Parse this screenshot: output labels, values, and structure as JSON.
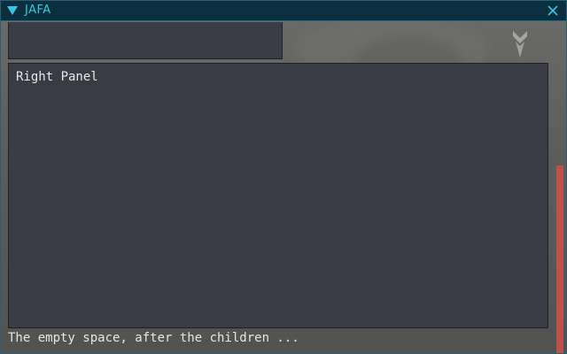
{
  "window": {
    "title": "JAFA"
  },
  "panels": {
    "right_panel_label": "Right Panel"
  },
  "footer": {
    "text": "The empty space, after the children ..."
  },
  "icons": {
    "collapse": "triangle-down-icon",
    "close": "close-icon",
    "logo": "emblem-icon"
  },
  "colors": {
    "accent": "#35c8e6",
    "titlebar": "#0c2f3d",
    "panel": "#393c45",
    "scrollbar": "#c0504a"
  }
}
